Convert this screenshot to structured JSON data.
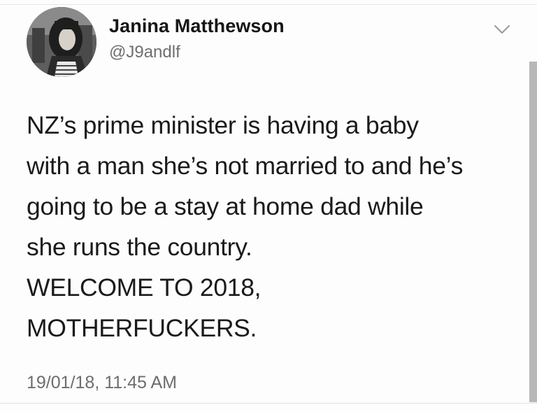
{
  "user": {
    "display_name": "Janina Matthewson",
    "handle": "@J9andlf",
    "avatar_icon": "profile-photo"
  },
  "tweet": {
    "lines": [
      "NZ’s prime minister is having a baby",
      "with a man she’s not married to and he’s",
      "going to be a stay at home dad while",
      "she runs the country.",
      "WELCOME TO 2018,",
      "MOTHERFUCKERS."
    ],
    "timestamp": "19/01/18, 11:45 AM"
  },
  "menu": {
    "icon": "chevron-down-icon"
  },
  "colors": {
    "text": "#1a1a1a",
    "secondary_text": "#6f6f6f",
    "background": "#fdfdfd",
    "chevron": "#9a9a9a"
  }
}
